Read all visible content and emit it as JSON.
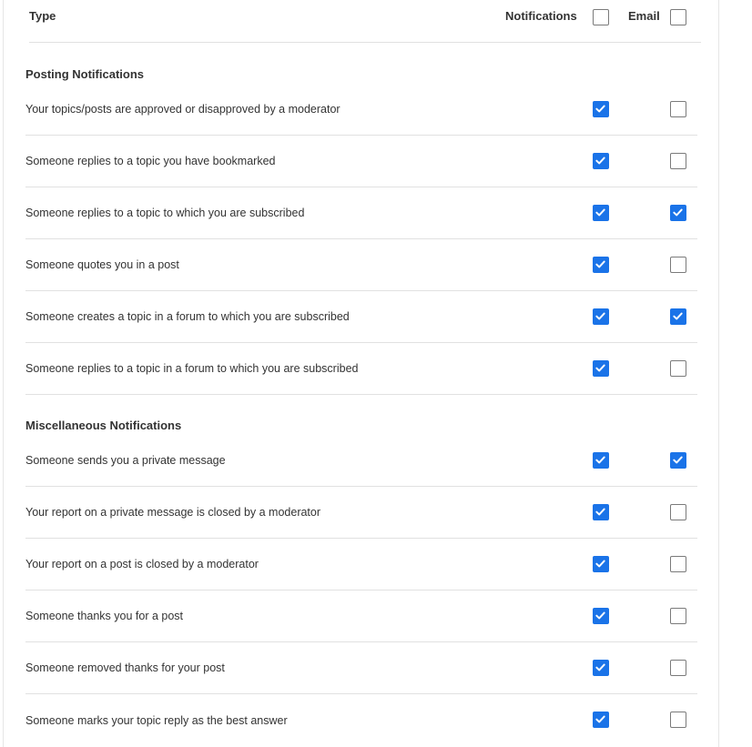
{
  "header": {
    "type_label": "Type",
    "notifications_label": "Notifications",
    "email_label": "Email",
    "notifications_all": false,
    "email_all": false
  },
  "sections": [
    {
      "title": "Posting Notifications",
      "items": [
        {
          "label": "Your topics/posts are approved or disapproved by a moderator",
          "notification": true,
          "email": false
        },
        {
          "label": "Someone replies to a topic you have bookmarked",
          "notification": true,
          "email": false
        },
        {
          "label": "Someone replies to a topic to which you are subscribed",
          "notification": true,
          "email": true
        },
        {
          "label": "Someone quotes you in a post",
          "notification": true,
          "email": false
        },
        {
          "label": "Someone creates a topic in a forum to which you are subscribed",
          "notification": true,
          "email": true
        },
        {
          "label": "Someone replies to a topic in a forum to which you are subscribed",
          "notification": true,
          "email": false
        }
      ]
    },
    {
      "title": "Miscellaneous Notifications",
      "items": [
        {
          "label": "Someone sends you a private message",
          "notification": true,
          "email": true
        },
        {
          "label": "Your report on a private message is closed by a moderator",
          "notification": true,
          "email": false
        },
        {
          "label": "Your report on a post is closed by a moderator",
          "notification": true,
          "email": false
        },
        {
          "label": "Someone thanks you for a post",
          "notification": true,
          "email": false
        },
        {
          "label": "Someone removed thanks for your post",
          "notification": true,
          "email": false
        },
        {
          "label": "Someone marks your topic reply as the best answer",
          "notification": true,
          "email": false
        }
      ]
    }
  ],
  "colors": {
    "accent": "#1a73e8",
    "text": "#333333",
    "divider": "#e1e1e1",
    "checkbox_border": "#7a7a7a"
  },
  "icons": {
    "checkmark": "check-icon"
  }
}
